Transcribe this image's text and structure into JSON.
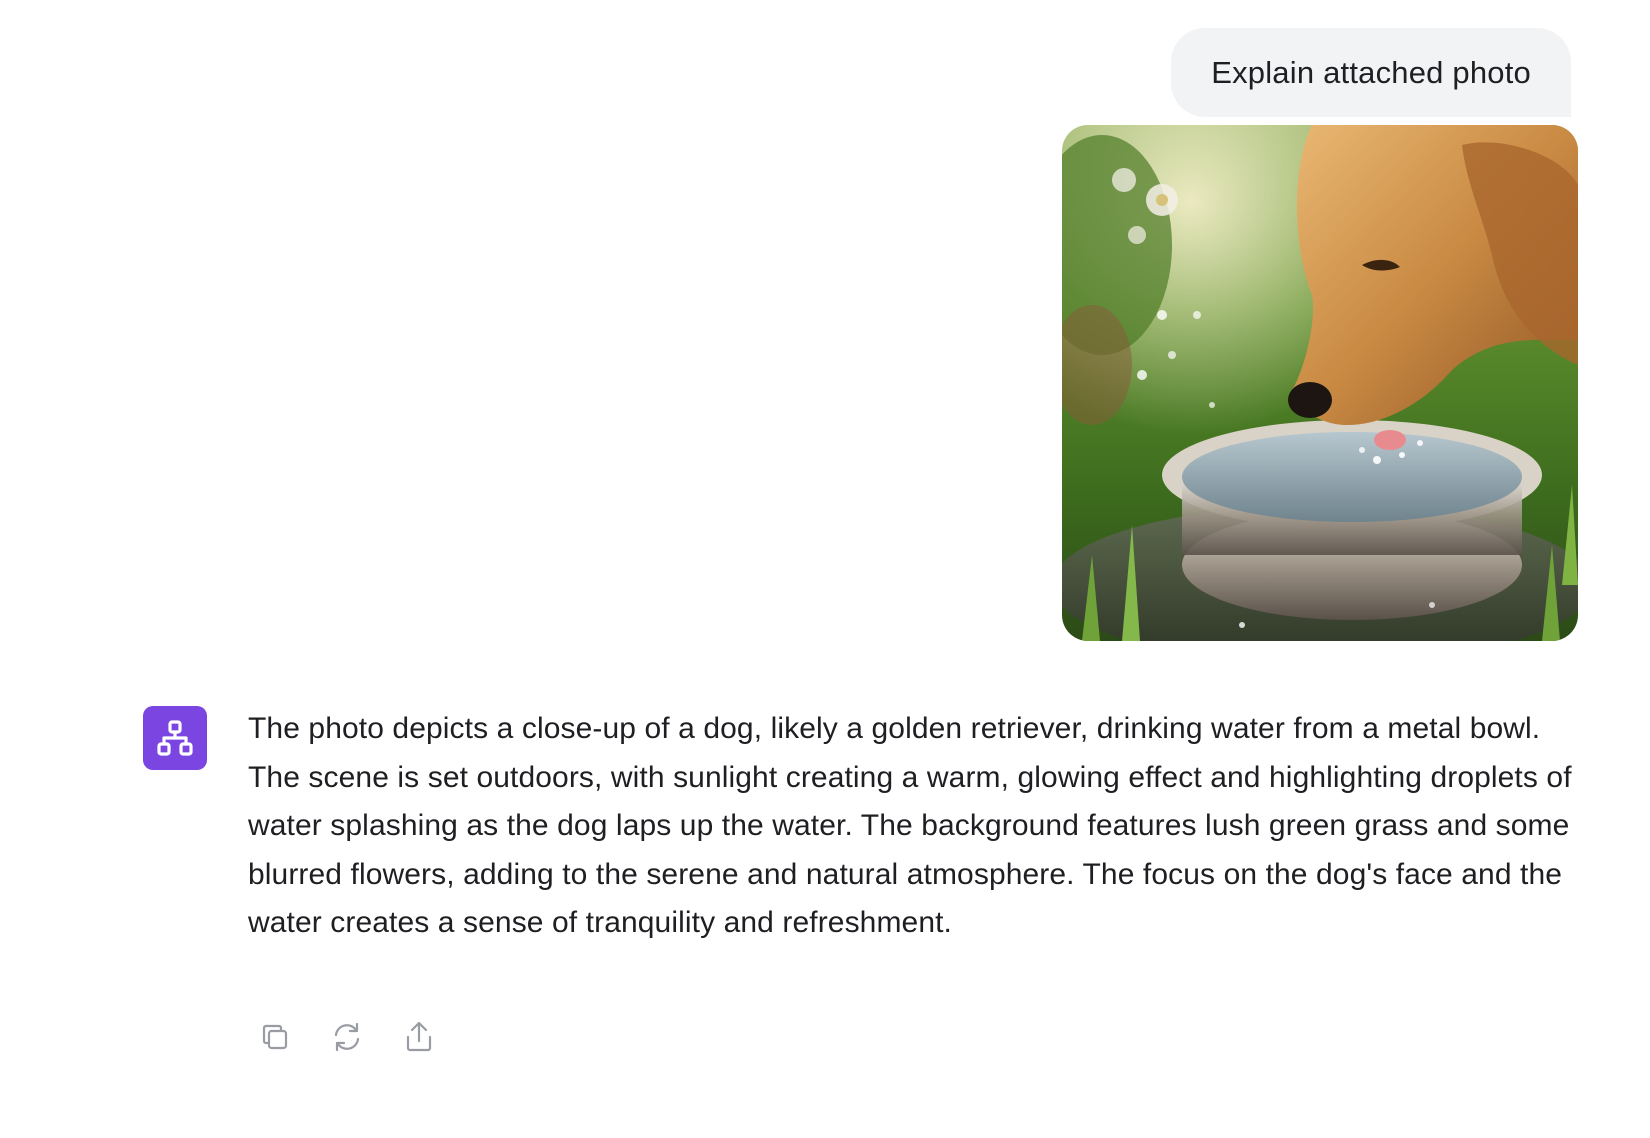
{
  "user_message": {
    "text": "Explain attached photo",
    "attachment": {
      "type": "photo",
      "icon": "photo-dog-drinking"
    }
  },
  "assistant_message": {
    "avatar_icon": "hierarchy-icon",
    "avatar_color": "#7a45e0",
    "text": "The photo depicts a close-up of a dog, likely a golden retriever, drinking water from a metal bowl. The scene is set outdoors, with sunlight creating a warm, glowing effect and highlighting droplets of water splashing as the dog laps up the water. The background features lush green grass and some blurred flowers, adding to the serene and natural atmosphere. The focus on the dog's face and the water creates a sense of tranquility and refreshment."
  },
  "actions": [
    {
      "icon": "copy-icon"
    },
    {
      "icon": "regenerate-icon"
    },
    {
      "icon": "share-icon"
    }
  ],
  "colors": {
    "bubble_bg": "#f2f3f5",
    "text": "#1f1f23",
    "icon_gray": "#9a9ca3"
  }
}
